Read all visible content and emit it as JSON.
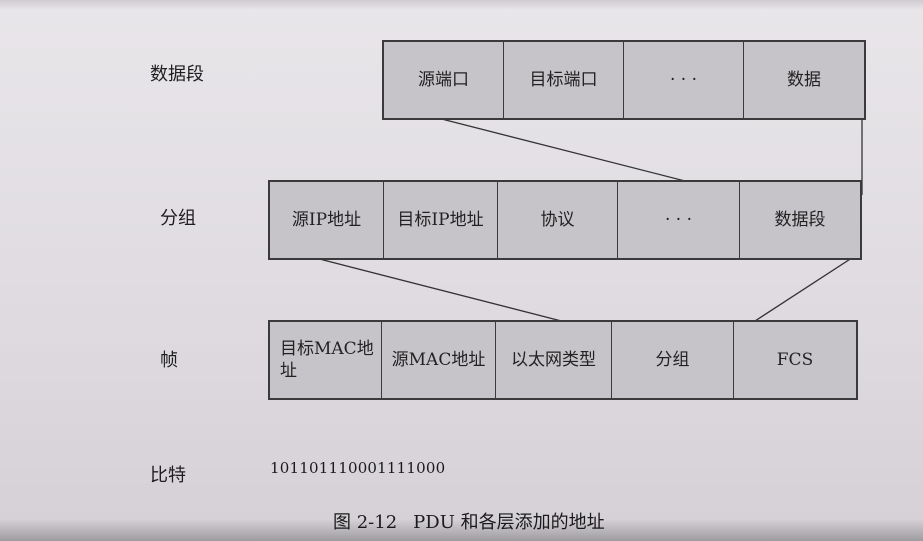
{
  "labels": {
    "segment": "数据段",
    "packet": "分组",
    "frame": "帧",
    "bits": "比特"
  },
  "segment_fields": [
    "源端口",
    "目标端口",
    "· · ·",
    "数据"
  ],
  "packet_fields": [
    "源IP地址",
    "目标IP地址",
    "协议",
    "· · ·",
    "数据段"
  ],
  "frame_fields": [
    "目标MAC地址",
    "源MAC地址",
    "以太网类型",
    "分组",
    "FCS"
  ],
  "bit_string": "101101110001111000",
  "caption": {
    "number": "图 2-12",
    "text": "PDU 和各层添加的地址"
  }
}
